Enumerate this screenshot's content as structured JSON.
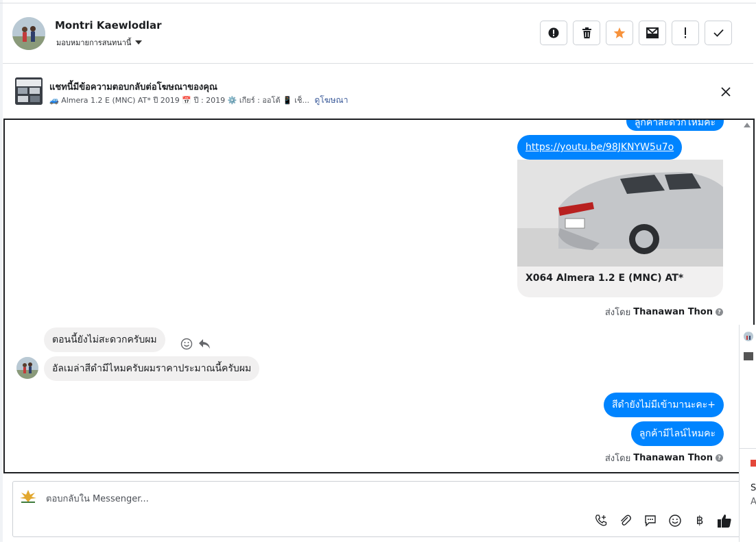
{
  "header": {
    "name": "Montri Kaewlodlar",
    "assign_label": "มอบหมายการสนทนานี้"
  },
  "actions": [
    {
      "name": "mark-spam-button",
      "icon": "alert-icon"
    },
    {
      "name": "delete-button",
      "icon": "trash-icon"
    },
    {
      "name": "star-button",
      "icon": "star-icon"
    },
    {
      "name": "mark-unread-button",
      "icon": "envelope-icon"
    },
    {
      "name": "follow-up-button",
      "icon": "exclamation-icon"
    },
    {
      "name": "done-button",
      "icon": "check-icon"
    }
  ],
  "ad": {
    "title": "แชทนี้มีข้อความตอบกลับต่อโฆษณาของคุณ",
    "details": "🚙 Almera 1.2 E (MNC) AT* ปี 2019 📅 ปี : 2019 ⚙️ เกียร์ : ออโต้ 📱 เช็...",
    "link": "ดูโฆษณา"
  },
  "messages": {
    "outgoing_partial": "ลูกค้าสะดวกไหมคะ",
    "outgoing_link": "https://youtu.be/98JKNYW5u7o",
    "card_title": "X064 Almera 1.2 E (MNC) AT*",
    "sent_by_prefix_1": "ส่งโดย",
    "sent_by_name_1": "Thanawan Thon",
    "incoming_1": "ตอนนี้ยังไม่สะดวกครับผม",
    "incoming_2": "อัลเมล่าสีดำมีไหมครับผมราคาประมาณนี้ครับผม",
    "outgoing_3": "สีดำยังไม่มีเข้ามานะคะ+",
    "outgoing_4": "ลูกค้ามีไลน์ไหมคะ",
    "sent_by_prefix_2": "ส่งโดย",
    "sent_by_name_2": "Thanawan Thon"
  },
  "composer": {
    "placeholder": "ตอบกลับใน Messenger...",
    "tools": [
      "phone-plus-icon",
      "paperclip-icon",
      "saved-reply-icon",
      "emoji-icon",
      "baht-icon",
      "thumbs-up-icon"
    ],
    "baht_symbol": "฿"
  },
  "side_fragment": {
    "letter_1": "S",
    "letter_2": "A"
  },
  "colors": {
    "accent": "#0084ff",
    "star": "#f7923b",
    "link": "#385898",
    "incoming_bubble": "#f1f0f0"
  }
}
